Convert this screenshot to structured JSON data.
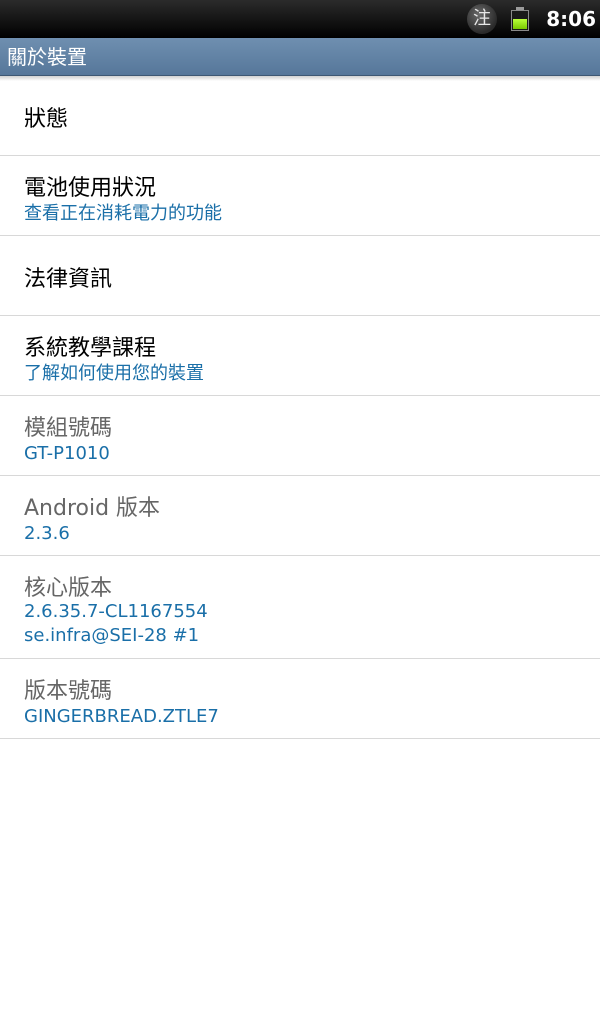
{
  "status_bar": {
    "ime_icon_label": "注",
    "ime_icon": "input-method-icon",
    "battery_icon": "battery-icon",
    "battery_level": 0.55,
    "battery_color": "#8fe000",
    "time": "8:06"
  },
  "title_bar": {
    "title": "關於裝置",
    "color": "#6484a6"
  },
  "accent_color": "#1a6fa8",
  "items": [
    {
      "title": "狀態",
      "subtitle": ""
    },
    {
      "title": "電池使用狀況",
      "subtitle": "查看正在消耗電力的功能"
    },
    {
      "title": "法律資訊",
      "subtitle": ""
    },
    {
      "title": "系統教學課程",
      "subtitle": "了解如何使用您的裝置"
    },
    {
      "title": "模組號碼",
      "subtitle": "GT-P1010"
    },
    {
      "title": "Android 版本",
      "subtitle": "2.3.6"
    },
    {
      "title": "核心版本",
      "subtitle": "2.6.35.7-CL1167554",
      "subtitle2": "se.infra@SEI-28 #1"
    },
    {
      "title": "版本號碼",
      "subtitle": "GINGERBREAD.ZTLE7"
    }
  ]
}
